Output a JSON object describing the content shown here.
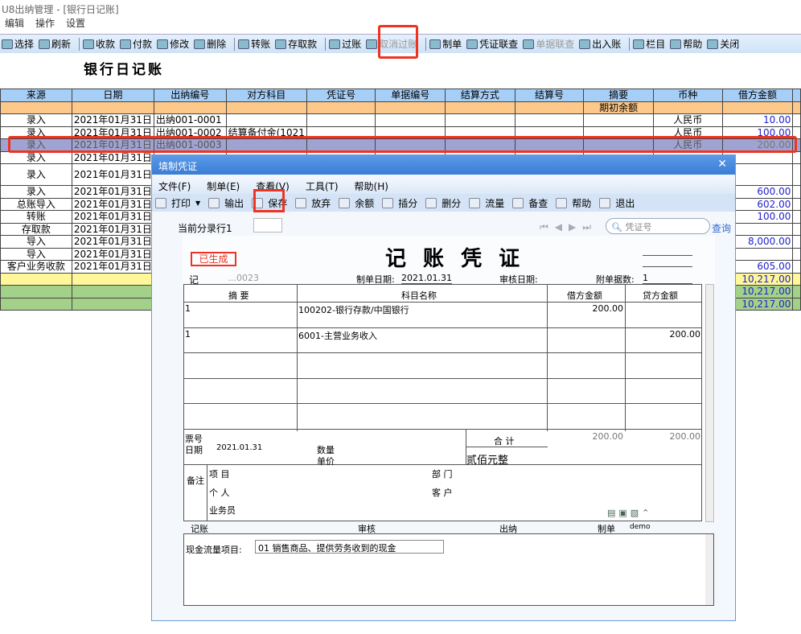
{
  "window": {
    "title": "U8出纳管理 - [银行日记账]",
    "menu": [
      "编辑",
      "操作",
      "设置"
    ]
  },
  "toolbar": [
    {
      "label": "选择",
      "icon": "select-icon"
    },
    {
      "label": "刷新",
      "icon": "refresh-icon"
    },
    {
      "label": "收款",
      "icon": "receipt-icon"
    },
    {
      "label": "付款",
      "icon": "payment-icon"
    },
    {
      "label": "修改",
      "icon": "edit-icon"
    },
    {
      "label": "删除",
      "icon": "delete-icon"
    },
    {
      "label": "转账",
      "icon": "transfer-icon"
    },
    {
      "label": "存取款",
      "icon": "deposit-icon"
    },
    {
      "label": "过账",
      "icon": "post-icon"
    },
    {
      "label": "取消过账",
      "icon": "unpost-icon",
      "disabled": true
    },
    {
      "label": "制单",
      "icon": "make-voucher-icon"
    },
    {
      "label": "凭证联查",
      "icon": "voucher-query-icon"
    },
    {
      "label": "单据联查",
      "icon": "bill-query-icon",
      "disabled": true
    },
    {
      "label": "出入账",
      "icon": "in-out-icon"
    },
    {
      "label": "栏目",
      "icon": "columns-icon"
    },
    {
      "label": "帮助",
      "icon": "help-icon"
    },
    {
      "label": "关闭",
      "icon": "close-icon"
    }
  ],
  "page_title": "银行日记账",
  "table": {
    "headers": [
      "来源",
      "日期",
      "出纳编号",
      "对方科目",
      "凭证号",
      "单据编号",
      "结算方式",
      "结算号",
      "摘要",
      "币种",
      "借方金额"
    ],
    "opening_label": "期初余额",
    "rows": [
      {
        "src": "录入",
        "date": "2021年01月31日",
        "no": "出纳001-0001",
        "acct": "",
        "cur": "人民币",
        "debit": "10.00"
      },
      {
        "src": "录入",
        "date": "2021年01月31日",
        "no": "出纳001-0002",
        "acct": "结算备付金(1021",
        "cur": "人民币",
        "debit": "100.00"
      },
      {
        "src": "录入",
        "date": "2021年01月31日",
        "no": "出纳001-0003",
        "acct": "",
        "cur": "人民币",
        "debit": "200.00"
      },
      {
        "src": "录入",
        "date": "2021年01月31日",
        "no": "",
        "acct": "",
        "cur": "",
        "debit": ""
      },
      {
        "src": "录入",
        "date": "2021年01月31日",
        "no": "",
        "acct": "",
        "cur": "",
        "debit": ""
      },
      {
        "src": "录入",
        "date": "2021年01月31日",
        "no": "",
        "acct": "",
        "cur": "",
        "debit": "600.00"
      },
      {
        "src": "总账导入",
        "date": "2021年01月31日",
        "no": "",
        "acct": "",
        "cur": "",
        "debit": "602.00"
      },
      {
        "src": "转账",
        "date": "2021年01月31日",
        "no": "",
        "acct": "",
        "cur": "",
        "debit": "100.00"
      },
      {
        "src": "存取款",
        "date": "2021年01月31日",
        "no": "",
        "acct": "",
        "cur": "",
        "debit": ""
      },
      {
        "src": "导入",
        "date": "2021年01月31日",
        "no": "",
        "acct": "",
        "cur": "",
        "debit": "8,000.00"
      },
      {
        "src": "导入",
        "date": "2021年01月31日",
        "no": "",
        "acct": "",
        "cur": "",
        "debit": ""
      },
      {
        "src": "客户业务收款",
        "date": "2021年01月31日",
        "no": "",
        "acct": "",
        "cur": "",
        "debit": "605.00"
      }
    ],
    "totals": [
      "10,217.00",
      "10,217.00",
      "10,217.00"
    ]
  },
  "dialog": {
    "title": "填制凭证",
    "menu": [
      "文件(F)",
      "制单(E)",
      "查看(V)",
      "工具(T)",
      "帮助(H)"
    ],
    "toolbar": [
      "打印",
      "输出",
      "保存",
      "放弃",
      "余额",
      "插分",
      "删分",
      "流量",
      "备查",
      "帮助",
      "退出"
    ],
    "current_row_label": "当前分录行1",
    "search_placeholder": "凭证号",
    "query": "查询",
    "status": "已生成",
    "voucher_title": "记 账 凭 证",
    "voucher_type": "记",
    "voucher_no": "0023",
    "make_date_label": "制单日期:",
    "make_date": "2021.01.31",
    "audit_date_label": "审核日期:",
    "attach_label": "附单据数:",
    "attach": "1",
    "cols": [
      "摘 要",
      "科目名称",
      "借方金额",
      "贷方金额"
    ],
    "entries": [
      {
        "summary": "1",
        "account": "100202-银行存款/中国银行",
        "debit": "200.00",
        "credit": ""
      },
      {
        "summary": "1",
        "account": "6001-主营业务收入",
        "debit": "",
        "credit": "200.00"
      }
    ],
    "ticket_label": "票号",
    "date_label": "日期",
    "date": "2021.01.31",
    "qty_label": "数量",
    "price_label": "单价",
    "total_label": "合 计",
    "total_debit": "200.00",
    "total_credit": "200.00",
    "total_words": "贰佰元整",
    "remark_label": "备注",
    "project_label": "项 目",
    "dept_label": "部 门",
    "person_label": "个 人",
    "customer_label": "客 户",
    "salesman_label": "业务员",
    "sign": {
      "post": "记账",
      "audit": "审核",
      "cashier": "出纳",
      "maker": "制单",
      "maker_name": "demo"
    },
    "cashflow_label": "现金流量项目:",
    "cashflow_value": "01 销售商品、提供劳务收到的现金"
  }
}
